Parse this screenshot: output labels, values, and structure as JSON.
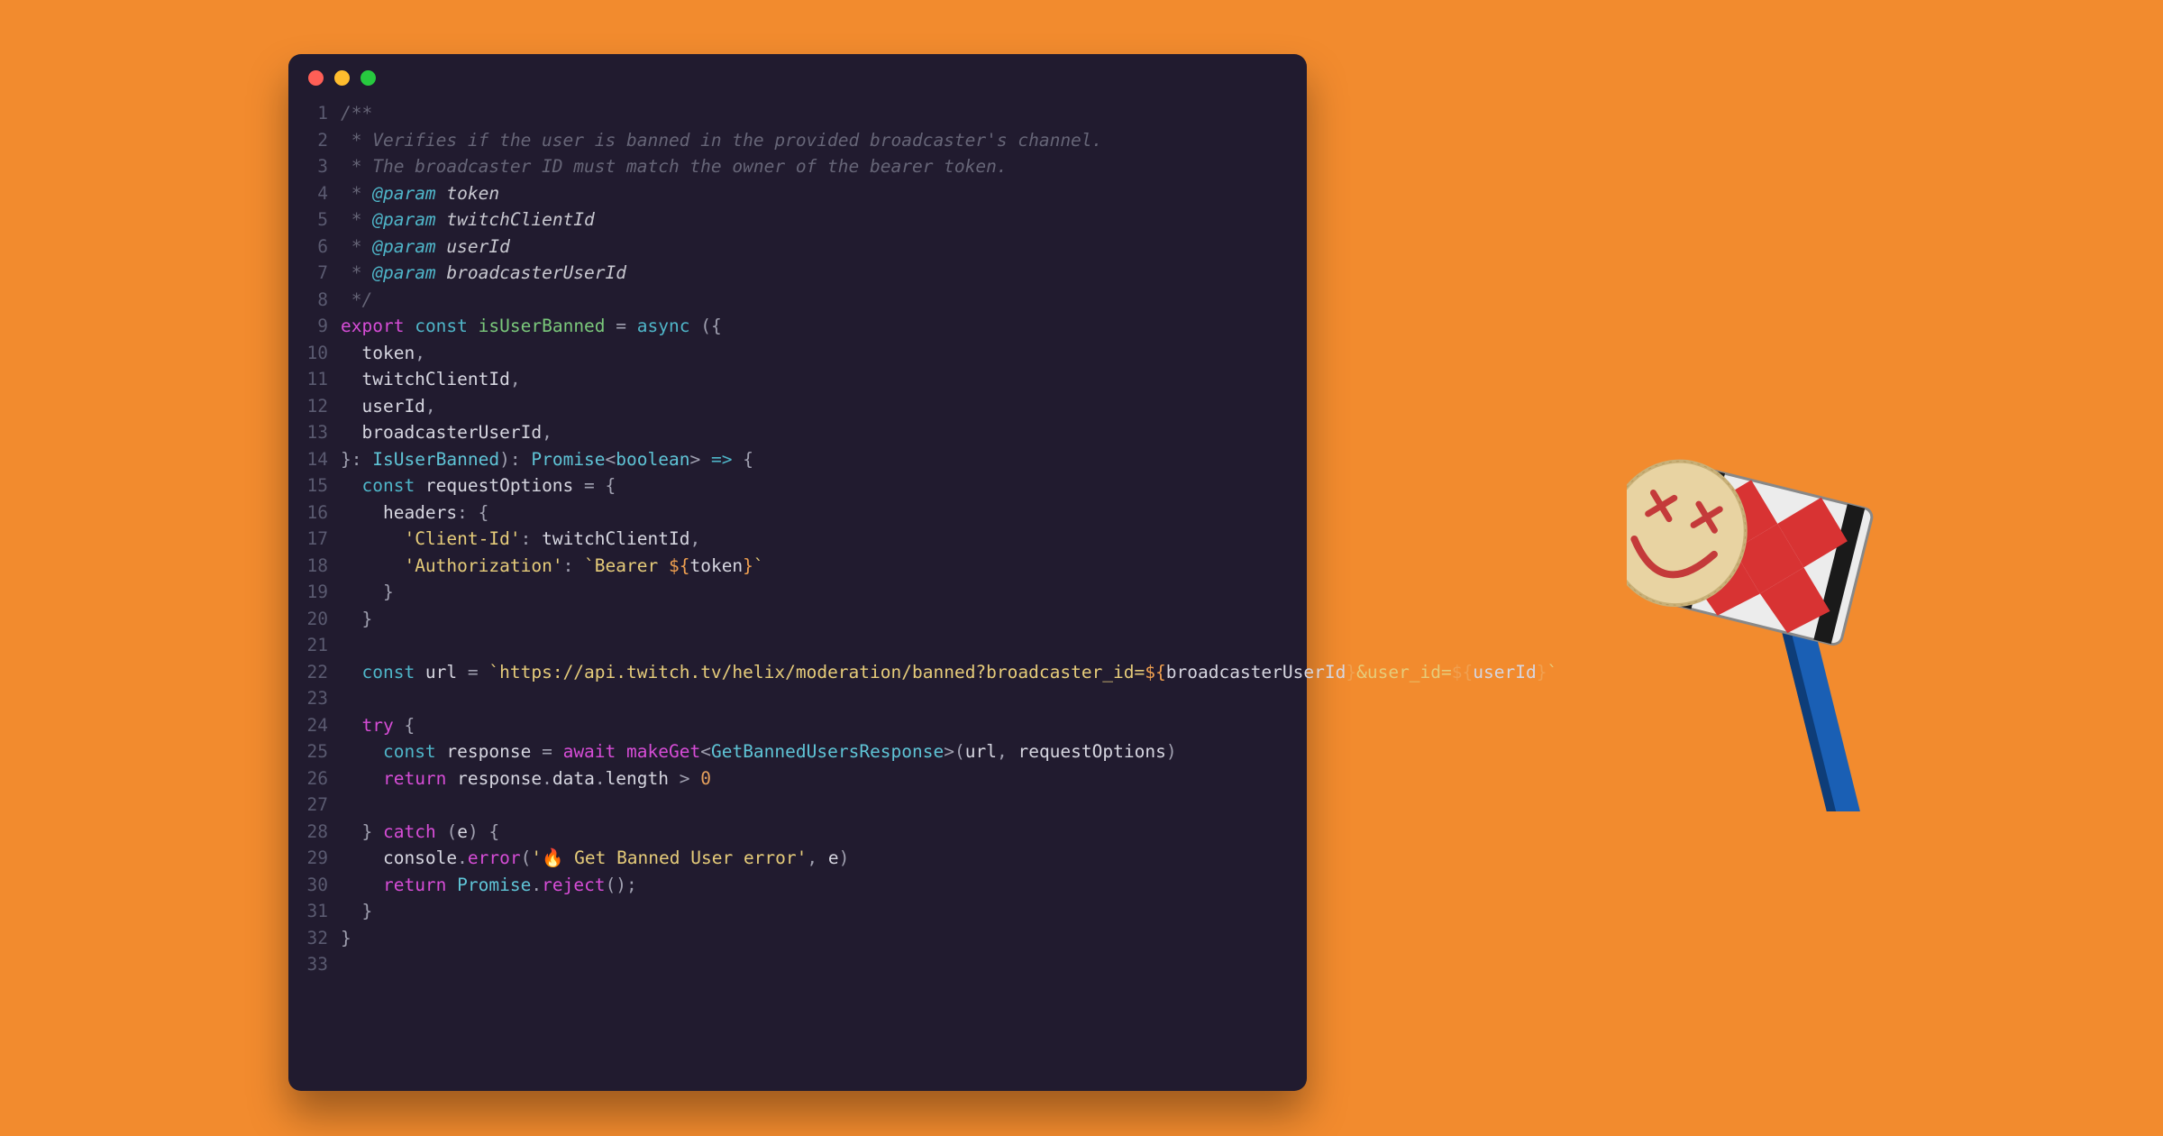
{
  "window": {
    "dots": [
      "red",
      "yellow",
      "green"
    ]
  },
  "code": {
    "lines": [
      {
        "n": "1",
        "tokens": [
          [
            "c-comment",
            "/**"
          ]
        ]
      },
      {
        "n": "2",
        "tokens": [
          [
            "c-comment",
            " * Verifies if the user is banned in the provided broadcaster's channel."
          ]
        ]
      },
      {
        "n": "3",
        "tokens": [
          [
            "c-comment",
            " * The broadcaster ID must match the owner of the bearer token."
          ]
        ]
      },
      {
        "n": "4",
        "tokens": [
          [
            "c-comment",
            " * "
          ],
          [
            "c-doctag",
            "@param"
          ],
          [
            "c-docparam",
            " token"
          ]
        ]
      },
      {
        "n": "5",
        "tokens": [
          [
            "c-comment",
            " * "
          ],
          [
            "c-doctag",
            "@param"
          ],
          [
            "c-docparam",
            " twitchClientId"
          ]
        ]
      },
      {
        "n": "6",
        "tokens": [
          [
            "c-comment",
            " * "
          ],
          [
            "c-doctag",
            "@param"
          ],
          [
            "c-docparam",
            " userId"
          ]
        ]
      },
      {
        "n": "7",
        "tokens": [
          [
            "c-comment",
            " * "
          ],
          [
            "c-doctag",
            "@param"
          ],
          [
            "c-docparam",
            " broadcasterUserId"
          ]
        ]
      },
      {
        "n": "8",
        "tokens": [
          [
            "c-comment",
            " */"
          ]
        ]
      },
      {
        "n": "9",
        "tokens": [
          [
            "c-keyword",
            "export"
          ],
          [
            "c-text",
            " "
          ],
          [
            "c-keyword2",
            "const"
          ],
          [
            "c-text",
            " "
          ],
          [
            "c-func",
            "isUserBanned"
          ],
          [
            "c-text",
            " "
          ],
          [
            "c-punct",
            "="
          ],
          [
            "c-text",
            " "
          ],
          [
            "c-keyword2",
            "async"
          ],
          [
            "c-text",
            " "
          ],
          [
            "c-punct",
            "({"
          ]
        ]
      },
      {
        "n": "10",
        "tokens": [
          [
            "c-text",
            "  token"
          ],
          [
            "c-punct",
            ","
          ]
        ]
      },
      {
        "n": "11",
        "tokens": [
          [
            "c-text",
            "  twitchClientId"
          ],
          [
            "c-punct",
            ","
          ]
        ]
      },
      {
        "n": "12",
        "tokens": [
          [
            "c-text",
            "  userId"
          ],
          [
            "c-punct",
            ","
          ]
        ]
      },
      {
        "n": "13",
        "tokens": [
          [
            "c-text",
            "  broadcasterUserId"
          ],
          [
            "c-punct",
            ","
          ]
        ]
      },
      {
        "n": "14",
        "tokens": [
          [
            "c-punct",
            "}: "
          ],
          [
            "c-type",
            "IsUserBanned"
          ],
          [
            "c-punct",
            "): "
          ],
          [
            "c-type",
            "Promise"
          ],
          [
            "c-punct",
            "<"
          ],
          [
            "c-type",
            "boolean"
          ],
          [
            "c-punct",
            ">"
          ],
          [
            "c-text",
            " "
          ],
          [
            "c-keyword2",
            "=>"
          ],
          [
            "c-text",
            " "
          ],
          [
            "c-punct",
            "{"
          ]
        ]
      },
      {
        "n": "15",
        "tokens": [
          [
            "c-text",
            "  "
          ],
          [
            "c-keyword2",
            "const"
          ],
          [
            "c-text",
            " requestOptions "
          ],
          [
            "c-punct",
            "="
          ],
          [
            "c-text",
            " "
          ],
          [
            "c-punct",
            "{"
          ]
        ]
      },
      {
        "n": "16",
        "tokens": [
          [
            "c-text",
            "    headers"
          ],
          [
            "c-punct",
            ":"
          ],
          [
            "c-text",
            " "
          ],
          [
            "c-punct",
            "{"
          ]
        ]
      },
      {
        "n": "17",
        "tokens": [
          [
            "c-text",
            "      "
          ],
          [
            "c-string",
            "'Client-Id'"
          ],
          [
            "c-punct",
            ":"
          ],
          [
            "c-text",
            " twitchClientId"
          ],
          [
            "c-punct",
            ","
          ]
        ]
      },
      {
        "n": "18",
        "tokens": [
          [
            "c-text",
            "      "
          ],
          [
            "c-string",
            "'Authorization'"
          ],
          [
            "c-punct",
            ":"
          ],
          [
            "c-text",
            " "
          ],
          [
            "c-string",
            "`Bearer "
          ],
          [
            "c-orange",
            "${"
          ],
          [
            "c-text",
            "token"
          ],
          [
            "c-orange",
            "}"
          ],
          [
            "c-string",
            "`"
          ]
        ]
      },
      {
        "n": "19",
        "tokens": [
          [
            "c-text",
            "    "
          ],
          [
            "c-punct",
            "}"
          ]
        ]
      },
      {
        "n": "20",
        "tokens": [
          [
            "c-text",
            "  "
          ],
          [
            "c-punct",
            "}"
          ]
        ]
      },
      {
        "n": "21",
        "tokens": []
      },
      {
        "n": "22",
        "tokens": [
          [
            "c-text",
            "  "
          ],
          [
            "c-keyword2",
            "const"
          ],
          [
            "c-text",
            " url "
          ],
          [
            "c-punct",
            "="
          ],
          [
            "c-text",
            " "
          ],
          [
            "c-string",
            "`https://api.twitch.tv/helix/moderation/banned?broadcaster_id="
          ],
          [
            "c-orange",
            "${"
          ],
          [
            "c-text",
            "broadcasterUserId"
          ],
          [
            "c-orange",
            "}"
          ],
          [
            "c-string",
            "&user_id="
          ],
          [
            "c-orange",
            "${"
          ],
          [
            "c-text",
            "userId"
          ],
          [
            "c-orange",
            "}"
          ],
          [
            "c-string",
            "`"
          ]
        ]
      },
      {
        "n": "23",
        "tokens": []
      },
      {
        "n": "24",
        "tokens": [
          [
            "c-text",
            "  "
          ],
          [
            "c-keyword",
            "try"
          ],
          [
            "c-text",
            " "
          ],
          [
            "c-punct",
            "{"
          ]
        ]
      },
      {
        "n": "25",
        "tokens": [
          [
            "c-text",
            "    "
          ],
          [
            "c-keyword2",
            "const"
          ],
          [
            "c-text",
            " response "
          ],
          [
            "c-punct",
            "="
          ],
          [
            "c-text",
            " "
          ],
          [
            "c-keyword",
            "await"
          ],
          [
            "c-text",
            " "
          ],
          [
            "c-call",
            "makeGet"
          ],
          [
            "c-punct",
            "<"
          ],
          [
            "c-type",
            "GetBannedUsersResponse"
          ],
          [
            "c-punct",
            ">("
          ],
          [
            "c-text",
            "url"
          ],
          [
            "c-punct",
            ","
          ],
          [
            "c-text",
            " requestOptions"
          ],
          [
            "c-punct",
            ")"
          ]
        ]
      },
      {
        "n": "26",
        "tokens": [
          [
            "c-text",
            "    "
          ],
          [
            "c-keyword",
            "return"
          ],
          [
            "c-text",
            " response"
          ],
          [
            "c-punct",
            "."
          ],
          [
            "c-text",
            "data"
          ],
          [
            "c-punct",
            "."
          ],
          [
            "c-text",
            "length "
          ],
          [
            "c-punct",
            ">"
          ],
          [
            "c-text",
            " "
          ],
          [
            "c-num",
            "0"
          ]
        ]
      },
      {
        "n": "27",
        "tokens": []
      },
      {
        "n": "28",
        "tokens": [
          [
            "c-text",
            "  "
          ],
          [
            "c-punct",
            "}"
          ],
          [
            "c-text",
            " "
          ],
          [
            "c-keyword",
            "catch"
          ],
          [
            "c-text",
            " "
          ],
          [
            "c-punct",
            "("
          ],
          [
            "c-text",
            "e"
          ],
          [
            "c-punct",
            ")"
          ],
          [
            "c-text",
            " "
          ],
          [
            "c-punct",
            "{"
          ]
        ]
      },
      {
        "n": "29",
        "tokens": [
          [
            "c-text",
            "    console"
          ],
          [
            "c-punct",
            "."
          ],
          [
            "c-call",
            "error"
          ],
          [
            "c-punct",
            "("
          ],
          [
            "c-string",
            "'🔥 Get Banned User error'"
          ],
          [
            "c-punct",
            ","
          ],
          [
            "c-text",
            " e"
          ],
          [
            "c-punct",
            ")"
          ]
        ]
      },
      {
        "n": "30",
        "tokens": [
          [
            "c-text",
            "    "
          ],
          [
            "c-keyword",
            "return"
          ],
          [
            "c-text",
            " "
          ],
          [
            "c-type",
            "Promise"
          ],
          [
            "c-punct",
            "."
          ],
          [
            "c-call",
            "reject"
          ],
          [
            "c-punct",
            "();"
          ]
        ]
      },
      {
        "n": "31",
        "tokens": [
          [
            "c-text",
            "  "
          ],
          [
            "c-punct",
            "}"
          ]
        ]
      },
      {
        "n": "32",
        "tokens": [
          [
            "c-punct",
            "}"
          ]
        ]
      },
      {
        "n": "33",
        "tokens": []
      }
    ]
  },
  "decor": {
    "mallet_face": "x x smile"
  }
}
